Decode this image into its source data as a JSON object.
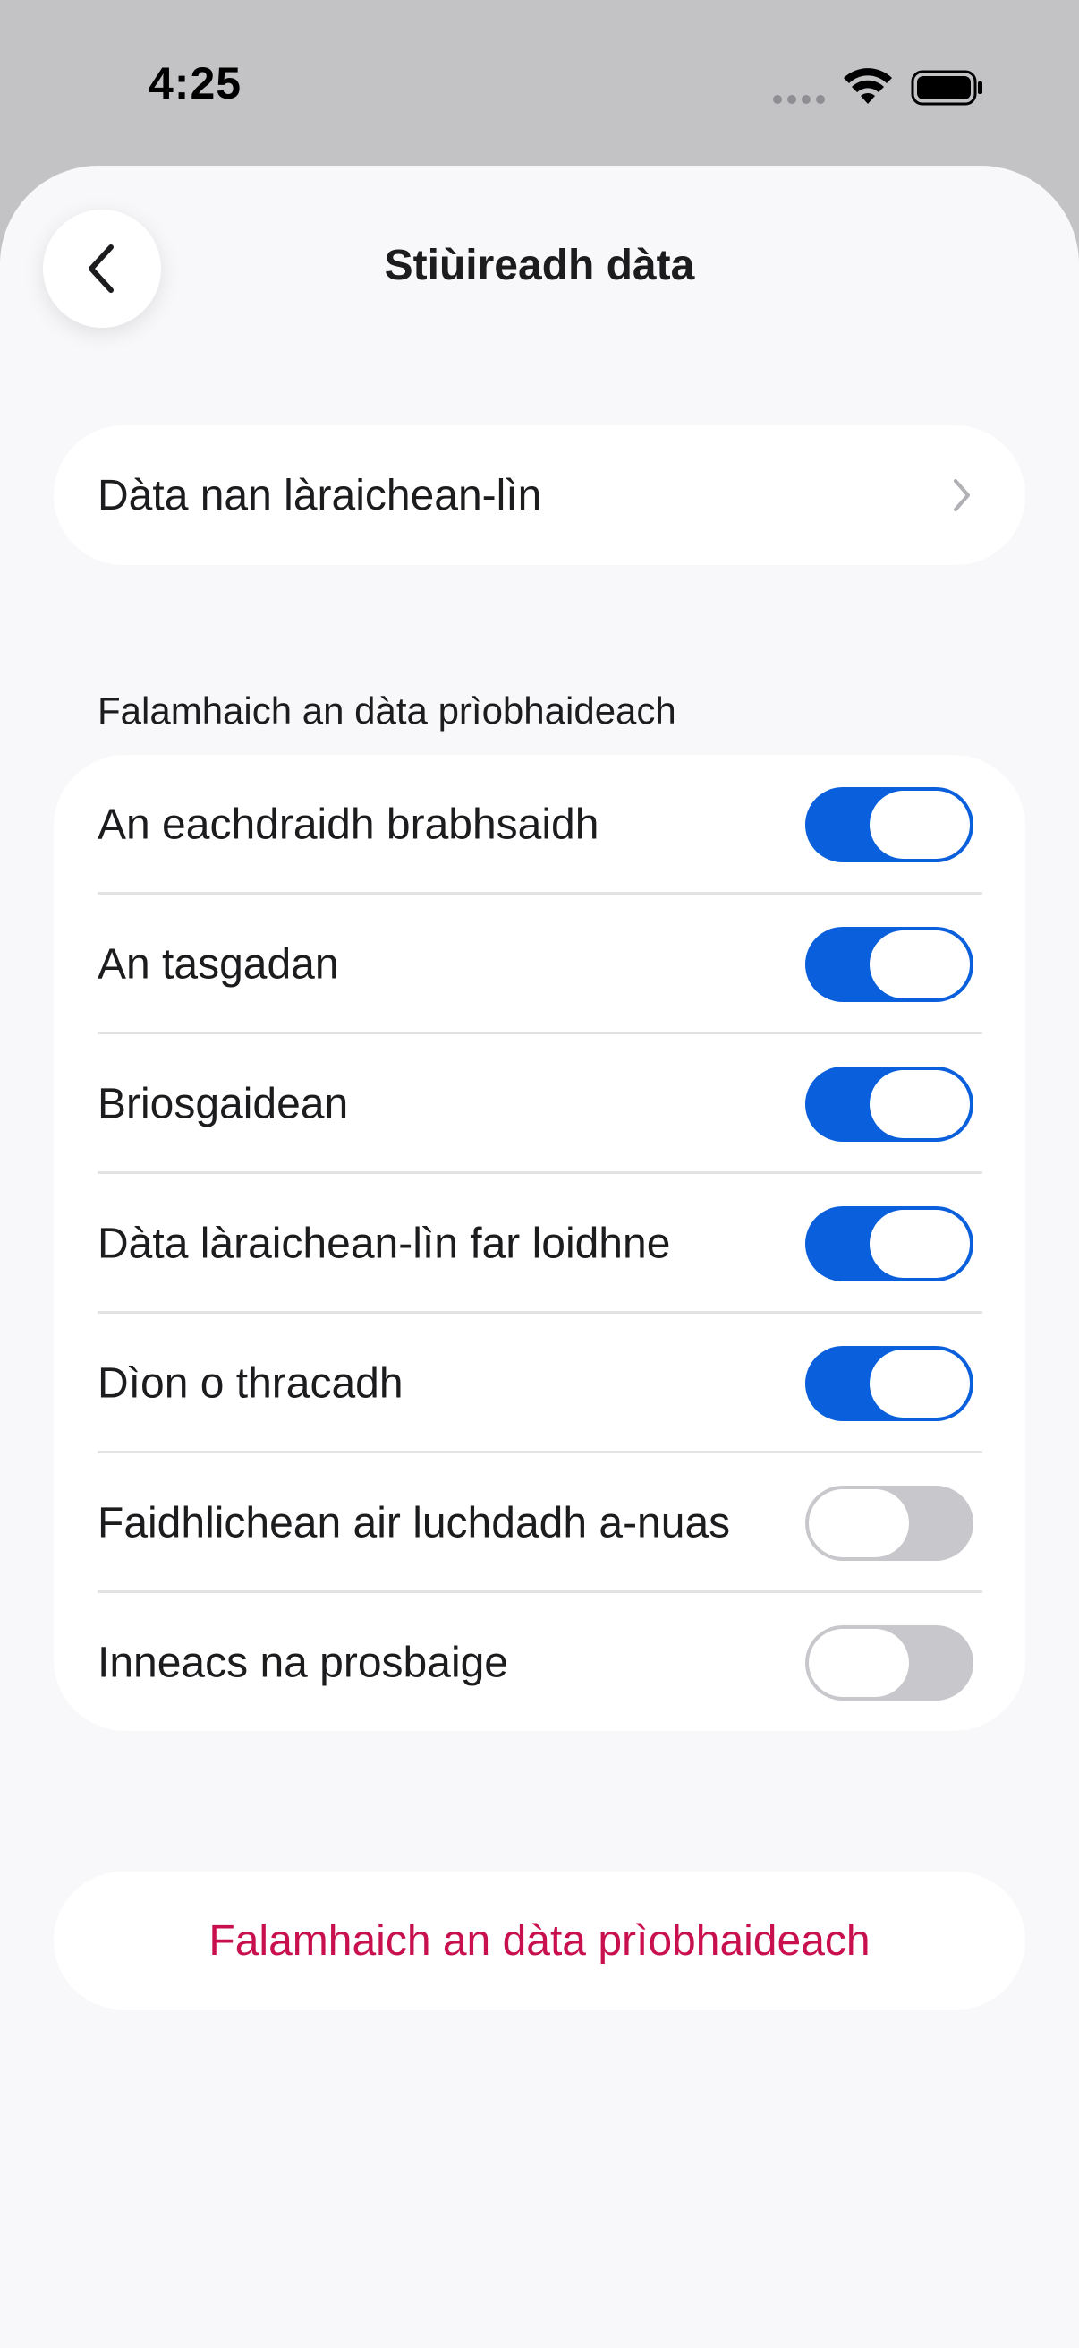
{
  "status_bar": {
    "time": "4:25"
  },
  "header": {
    "title": "Stiùireadh dàta",
    "back_icon": "chevron-left-icon"
  },
  "website_data_row": {
    "label": "Dàta nan làraichean-lìn",
    "icon": "chevron-right-icon"
  },
  "clear_section": {
    "header": "Falamhaich an dàta prìobhaideach",
    "items": [
      {
        "label": "An eachdraidh brabhsaidh",
        "enabled": true
      },
      {
        "label": "An tasgadan",
        "enabled": true
      },
      {
        "label": "Briosgaidean",
        "enabled": true
      },
      {
        "label": "Dàta làraichean-lìn far loidhne",
        "enabled": true
      },
      {
        "label": "Dìon o thracadh",
        "enabled": true
      },
      {
        "label": "Faidhlichean air luchdadh a-nuas",
        "enabled": false
      },
      {
        "label": "Inneacs na prosbaige",
        "enabled": false
      }
    ]
  },
  "clear_button": {
    "label": "Falamhaich an dàta prìobhaideach"
  },
  "colors": {
    "accent": "#0a5fdc",
    "destructive": "#c8104f",
    "sheet_background": "#f8f8fa",
    "card_background": "#ffffff"
  }
}
